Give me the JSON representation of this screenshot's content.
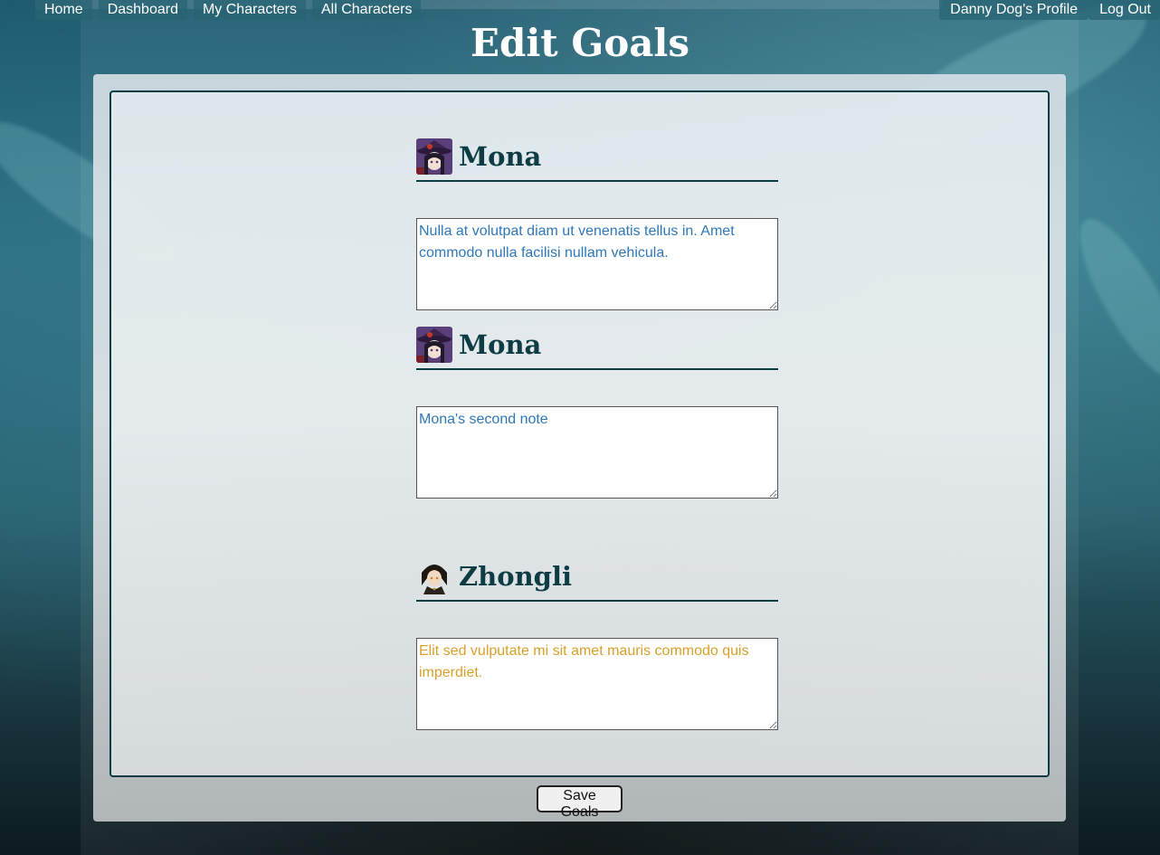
{
  "nav": {
    "left": [
      "Home",
      "Dashboard",
      "My Characters",
      "All Characters"
    ],
    "profile": "Danny Dog's Profile",
    "logout": "Log Out"
  },
  "page": {
    "title": "Edit Goals",
    "save_label": "Save Goals"
  },
  "goals": [
    {
      "character": "Mona",
      "avatar": "mona-avatar",
      "note": "Nulla at volutpat diam ut venenatis tellus in. Amet commodo nulla facilisi nullam vehicula.",
      "text_color": "#2e78b8"
    },
    {
      "character": "Mona",
      "avatar": "mona-avatar",
      "note": "Mona's second note",
      "text_color": "#2e78b8"
    },
    {
      "character": "Zhongli",
      "avatar": "zhongli-avatar",
      "note": "Elit sed vulputate mi sit amet mauris commodo quis imperdiet.",
      "text_color": "#d9a02a"
    }
  ],
  "colors": {
    "heading": "#0e3c44",
    "nav_bg": "#286473"
  }
}
